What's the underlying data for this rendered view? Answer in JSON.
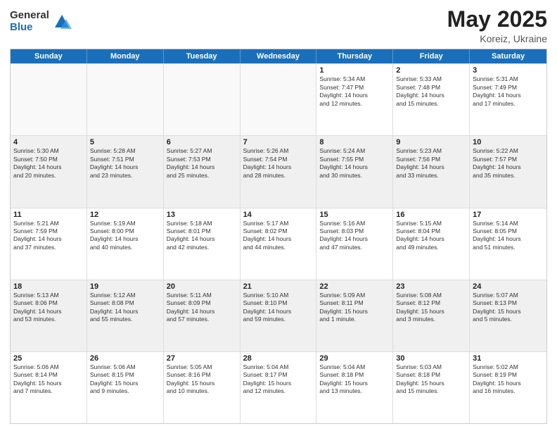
{
  "logo": {
    "general": "General",
    "blue": "Blue"
  },
  "title": {
    "month_year": "May 2025",
    "location": "Koreiz, Ukraine"
  },
  "header_days": [
    "Sunday",
    "Monday",
    "Tuesday",
    "Wednesday",
    "Thursday",
    "Friday",
    "Saturday"
  ],
  "rows": [
    [
      {
        "day": "",
        "empty": true
      },
      {
        "day": "",
        "empty": true
      },
      {
        "day": "",
        "empty": true
      },
      {
        "day": "",
        "empty": true
      },
      {
        "day": "1",
        "line1": "Sunrise: 5:34 AM",
        "line2": "Sunset: 7:47 PM",
        "line3": "Daylight: 14 hours",
        "line4": "and 12 minutes."
      },
      {
        "day": "2",
        "line1": "Sunrise: 5:33 AM",
        "line2": "Sunset: 7:48 PM",
        "line3": "Daylight: 14 hours",
        "line4": "and 15 minutes."
      },
      {
        "day": "3",
        "line1": "Sunrise: 5:31 AM",
        "line2": "Sunset: 7:49 PM",
        "line3": "Daylight: 14 hours",
        "line4": "and 17 minutes."
      }
    ],
    [
      {
        "day": "4",
        "line1": "Sunrise: 5:30 AM",
        "line2": "Sunset: 7:50 PM",
        "line3": "Daylight: 14 hours",
        "line4": "and 20 minutes."
      },
      {
        "day": "5",
        "line1": "Sunrise: 5:28 AM",
        "line2": "Sunset: 7:51 PM",
        "line3": "Daylight: 14 hours",
        "line4": "and 23 minutes."
      },
      {
        "day": "6",
        "line1": "Sunrise: 5:27 AM",
        "line2": "Sunset: 7:53 PM",
        "line3": "Daylight: 14 hours",
        "line4": "and 25 minutes."
      },
      {
        "day": "7",
        "line1": "Sunrise: 5:26 AM",
        "line2": "Sunset: 7:54 PM",
        "line3": "Daylight: 14 hours",
        "line4": "and 28 minutes."
      },
      {
        "day": "8",
        "line1": "Sunrise: 5:24 AM",
        "line2": "Sunset: 7:55 PM",
        "line3": "Daylight: 14 hours",
        "line4": "and 30 minutes."
      },
      {
        "day": "9",
        "line1": "Sunrise: 5:23 AM",
        "line2": "Sunset: 7:56 PM",
        "line3": "Daylight: 14 hours",
        "line4": "and 33 minutes."
      },
      {
        "day": "10",
        "line1": "Sunrise: 5:22 AM",
        "line2": "Sunset: 7:57 PM",
        "line3": "Daylight: 14 hours",
        "line4": "and 35 minutes."
      }
    ],
    [
      {
        "day": "11",
        "line1": "Sunrise: 5:21 AM",
        "line2": "Sunset: 7:59 PM",
        "line3": "Daylight: 14 hours",
        "line4": "and 37 minutes."
      },
      {
        "day": "12",
        "line1": "Sunrise: 5:19 AM",
        "line2": "Sunset: 8:00 PM",
        "line3": "Daylight: 14 hours",
        "line4": "and 40 minutes."
      },
      {
        "day": "13",
        "line1": "Sunrise: 5:18 AM",
        "line2": "Sunset: 8:01 PM",
        "line3": "Daylight: 14 hours",
        "line4": "and 42 minutes."
      },
      {
        "day": "14",
        "line1": "Sunrise: 5:17 AM",
        "line2": "Sunset: 8:02 PM",
        "line3": "Daylight: 14 hours",
        "line4": "and 44 minutes."
      },
      {
        "day": "15",
        "line1": "Sunrise: 5:16 AM",
        "line2": "Sunset: 8:03 PM",
        "line3": "Daylight: 14 hours",
        "line4": "and 47 minutes."
      },
      {
        "day": "16",
        "line1": "Sunrise: 5:15 AM",
        "line2": "Sunset: 8:04 PM",
        "line3": "Daylight: 14 hours",
        "line4": "and 49 minutes."
      },
      {
        "day": "17",
        "line1": "Sunrise: 5:14 AM",
        "line2": "Sunset: 8:05 PM",
        "line3": "Daylight: 14 hours",
        "line4": "and 51 minutes."
      }
    ],
    [
      {
        "day": "18",
        "line1": "Sunrise: 5:13 AM",
        "line2": "Sunset: 8:06 PM",
        "line3": "Daylight: 14 hours",
        "line4": "and 53 minutes."
      },
      {
        "day": "19",
        "line1": "Sunrise: 5:12 AM",
        "line2": "Sunset: 8:08 PM",
        "line3": "Daylight: 14 hours",
        "line4": "and 55 minutes."
      },
      {
        "day": "20",
        "line1": "Sunrise: 5:11 AM",
        "line2": "Sunset: 8:09 PM",
        "line3": "Daylight: 14 hours",
        "line4": "and 57 minutes."
      },
      {
        "day": "21",
        "line1": "Sunrise: 5:10 AM",
        "line2": "Sunset: 8:10 PM",
        "line3": "Daylight: 14 hours",
        "line4": "and 59 minutes."
      },
      {
        "day": "22",
        "line1": "Sunrise: 5:09 AM",
        "line2": "Sunset: 8:11 PM",
        "line3": "Daylight: 15 hours",
        "line4": "and 1 minute."
      },
      {
        "day": "23",
        "line1": "Sunrise: 5:08 AM",
        "line2": "Sunset: 8:12 PM",
        "line3": "Daylight: 15 hours",
        "line4": "and 3 minutes."
      },
      {
        "day": "24",
        "line1": "Sunrise: 5:07 AM",
        "line2": "Sunset: 8:13 PM",
        "line3": "Daylight: 15 hours",
        "line4": "and 5 minutes."
      }
    ],
    [
      {
        "day": "25",
        "line1": "Sunrise: 5:06 AM",
        "line2": "Sunset: 8:14 PM",
        "line3": "Daylight: 15 hours",
        "line4": "and 7 minutes."
      },
      {
        "day": "26",
        "line1": "Sunrise: 5:06 AM",
        "line2": "Sunset: 8:15 PM",
        "line3": "Daylight: 15 hours",
        "line4": "and 9 minutes."
      },
      {
        "day": "27",
        "line1": "Sunrise: 5:05 AM",
        "line2": "Sunset: 8:16 PM",
        "line3": "Daylight: 15 hours",
        "line4": "and 10 minutes."
      },
      {
        "day": "28",
        "line1": "Sunrise: 5:04 AM",
        "line2": "Sunset: 8:17 PM",
        "line3": "Daylight: 15 hours",
        "line4": "and 12 minutes."
      },
      {
        "day": "29",
        "line1": "Sunrise: 5:04 AM",
        "line2": "Sunset: 8:18 PM",
        "line3": "Daylight: 15 hours",
        "line4": "and 13 minutes."
      },
      {
        "day": "30",
        "line1": "Sunrise: 5:03 AM",
        "line2": "Sunset: 8:18 PM",
        "line3": "Daylight: 15 hours",
        "line4": "and 15 minutes."
      },
      {
        "day": "31",
        "line1": "Sunrise: 5:02 AM",
        "line2": "Sunset: 8:19 PM",
        "line3": "Daylight: 15 hours",
        "line4": "and 16 minutes."
      }
    ]
  ]
}
